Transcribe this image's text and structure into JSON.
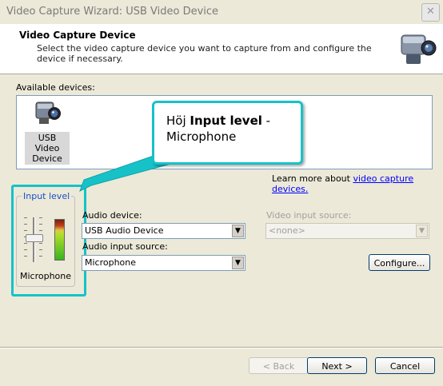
{
  "window": {
    "title": "Video Capture Wizard: USB Video Device",
    "close_glyph": "✕"
  },
  "header": {
    "title": "Video Capture Device",
    "subtitle": "Select the video capture device you want to capture from and configure the device if necessary.",
    "icon": "camcorder-icon"
  },
  "devices": {
    "label": "Available devices:",
    "items": [
      {
        "label": "USB Video Device",
        "icon": "webcam-icon"
      }
    ]
  },
  "learn_more": {
    "prefix": "Learn more about ",
    "link": "video capture devices."
  },
  "input_level": {
    "title": "Input level",
    "caption": "Microphone",
    "meter_level": 0.7,
    "slider_level": 0.55
  },
  "audio": {
    "device_label": "Audio device:",
    "device_value": "USB Audio Device",
    "source_label": "Audio input source:",
    "source_value": "Microphone"
  },
  "video": {
    "source_label": "Video input source:",
    "source_value": "<none>"
  },
  "buttons": {
    "configure": "Configure...",
    "back": "< Back",
    "next": "Next >",
    "cancel": "Cancel"
  },
  "callout": {
    "prefix": "Höj ",
    "bold": "Input level",
    "suffix": " -",
    "line2": "Microphone"
  },
  "colors": {
    "highlight": "#16c2c8",
    "link": "#0000ff",
    "group_title": "#1650c8"
  }
}
